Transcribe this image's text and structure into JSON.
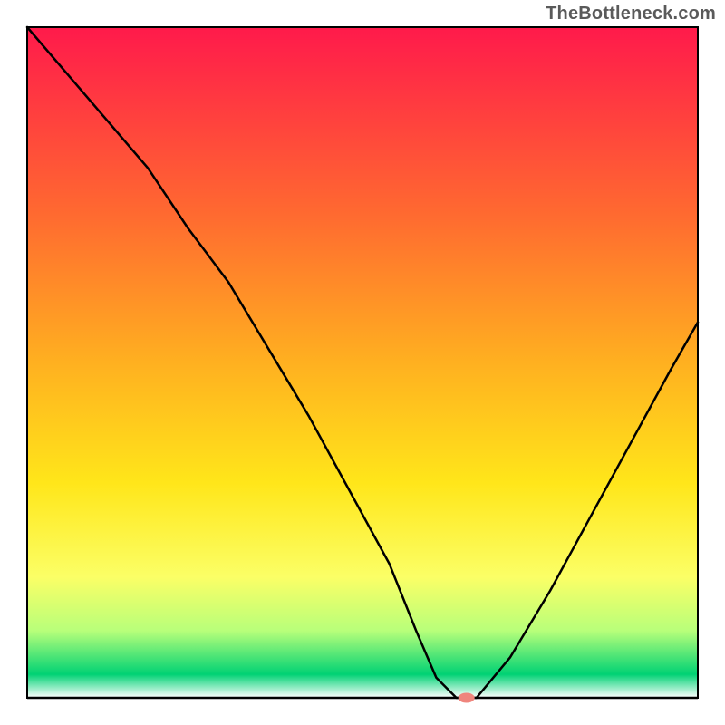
{
  "watermark": "TheBottleneck.com",
  "chart_data": {
    "type": "line",
    "title": "",
    "xlabel": "",
    "ylabel": "",
    "xlim": [
      0,
      100
    ],
    "ylim": [
      0,
      100
    ],
    "grid": false,
    "legend": false,
    "background_gradient_stops": [
      {
        "offset": 0.0,
        "color": "#ff1a4b"
      },
      {
        "offset": 0.28,
        "color": "#ff6a30"
      },
      {
        "offset": 0.5,
        "color": "#ffb020"
      },
      {
        "offset": 0.68,
        "color": "#ffe61a"
      },
      {
        "offset": 0.82,
        "color": "#fbff66"
      },
      {
        "offset": 0.9,
        "color": "#b8ff7a"
      },
      {
        "offset": 0.965,
        "color": "#00d274"
      },
      {
        "offset": 1.0,
        "color": "#ffffff"
      }
    ],
    "series": [
      {
        "name": "bottleneck-curve",
        "color": "#000000",
        "stroke_width": 2.5,
        "x": [
          0,
          6,
          12,
          18,
          24,
          30,
          36,
          42,
          48,
          54,
          58,
          61,
          64,
          67,
          72,
          78,
          84,
          90,
          96,
          100
        ],
        "y": [
          100,
          93,
          86,
          79,
          70,
          62,
          52,
          42,
          31,
          20,
          10,
          3,
          0,
          0,
          6,
          16,
          27,
          38,
          49,
          56
        ]
      }
    ],
    "floor_line": {
      "y": 0,
      "color": "#000000",
      "stroke_width": 2.5
    },
    "marker": {
      "name": "optimal-point",
      "x": 65.5,
      "y": 0,
      "rx": 9,
      "ry": 5.5,
      "fill": "#ef857d"
    }
  }
}
